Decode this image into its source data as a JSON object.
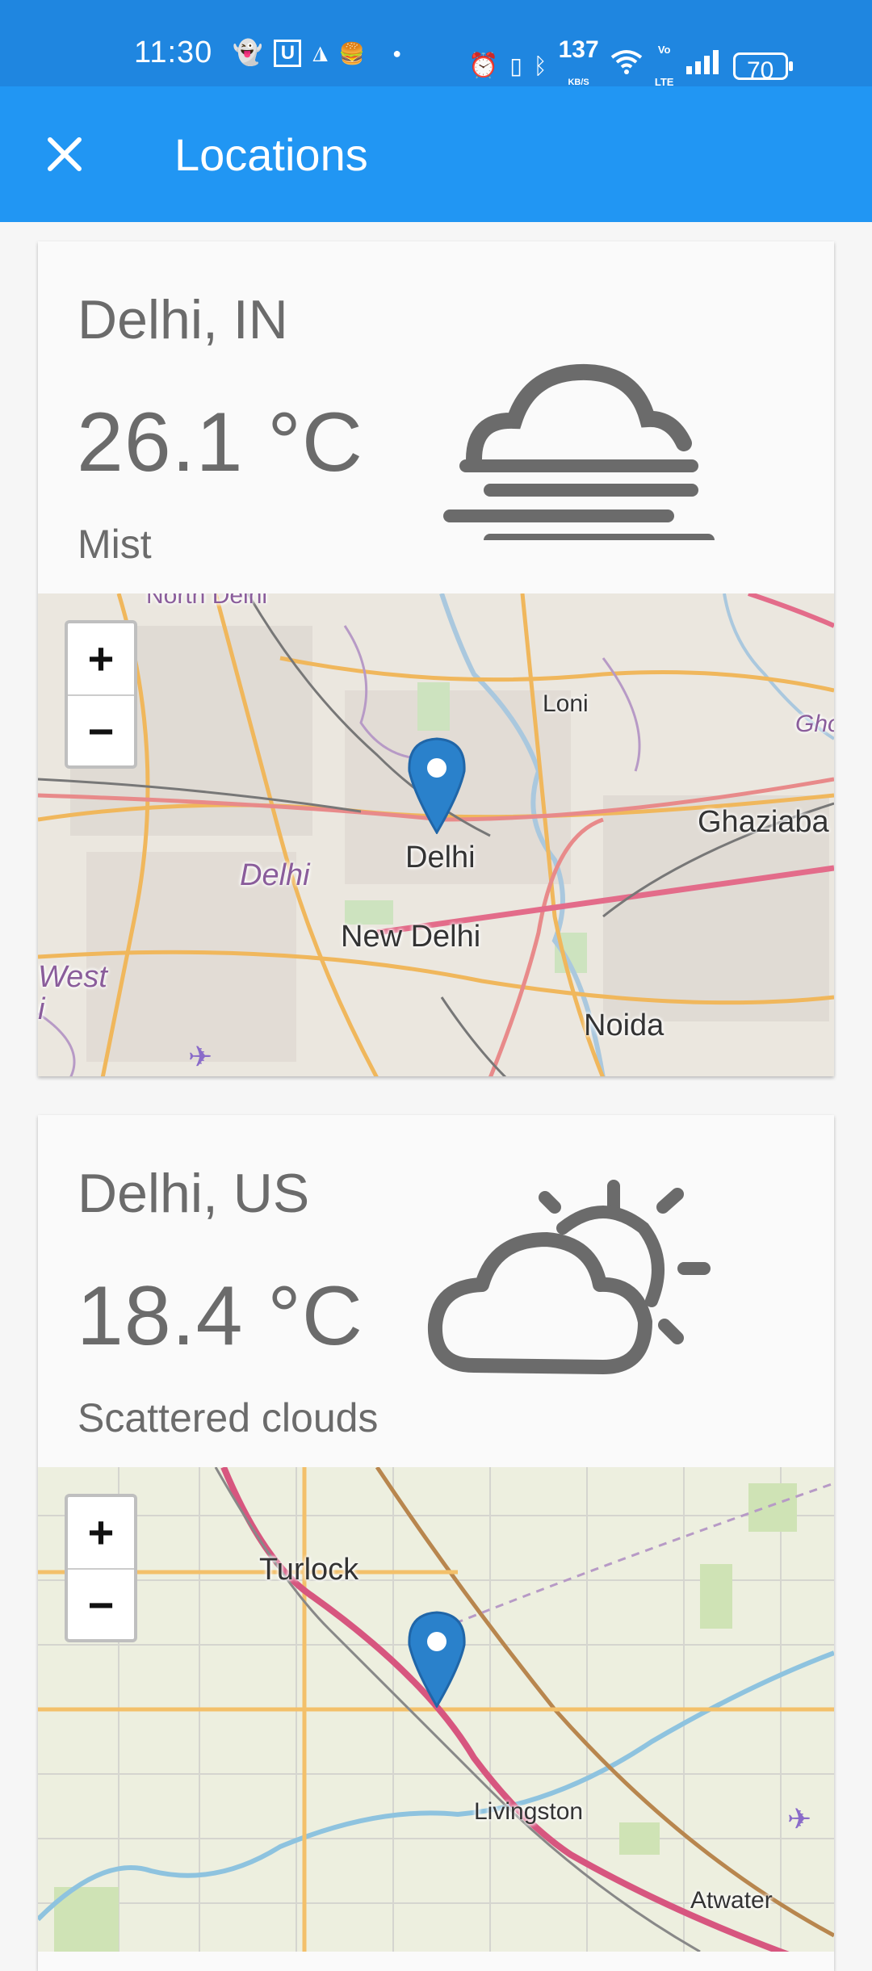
{
  "status_bar": {
    "time": "11:30",
    "net_speed_value": "137",
    "net_speed_unit": "KB/S",
    "volte": "Vo LTE",
    "battery": "70"
  },
  "app_bar": {
    "title": "Locations",
    "close_icon": "close-icon"
  },
  "locations": [
    {
      "city": "Delhi, IN",
      "temperature": "26.1 °C",
      "description": "Mist",
      "weather_icon": "mist-icon",
      "map": {
        "zoom_in": "+",
        "zoom_out": "−",
        "labels": [
          "North Delhi",
          "Loni",
          "Gho",
          "Ghaziaba",
          "Delhi",
          "Delhi",
          "New Delhi",
          "West",
          "i",
          "Noida"
        ]
      }
    },
    {
      "city": "Delhi, US",
      "temperature": "18.4 °C",
      "description": "Scattered clouds",
      "weather_icon": "partly-cloudy-icon",
      "map": {
        "zoom_in": "+",
        "zoom_out": "−",
        "labels": [
          "Turlock",
          "Livingston",
          "Atwater"
        ]
      }
    }
  ],
  "colors": {
    "status_bar": "#1f86e0",
    "app_bar": "#2196f3",
    "text_gray": "#6b6b6b",
    "marker_blue": "#2a81cb"
  }
}
